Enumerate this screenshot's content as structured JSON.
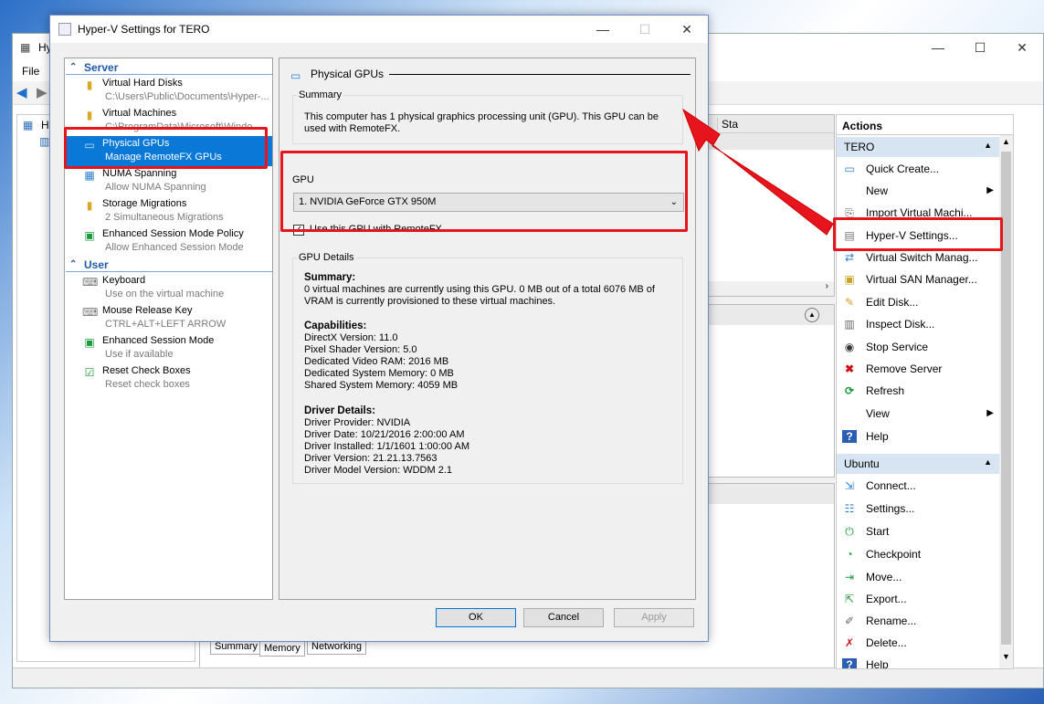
{
  "manager": {
    "title_fragment": "Hy",
    "menu": [
      "File"
    ],
    "tree_item": "Hy",
    "column_fragment": "Sta",
    "tabs": [
      "Summary",
      "Memory",
      "Networking"
    ]
  },
  "actions": {
    "header": "Actions",
    "groups": [
      {
        "name": "TERO",
        "items": [
          {
            "label": "Quick Create...",
            "icon": "monitor-icon"
          },
          {
            "label": "New",
            "icon": "none",
            "submenu": true
          },
          {
            "label": "Import Virtual Machi...",
            "icon": "import-icon"
          },
          {
            "label": "Hyper-V Settings...",
            "icon": "settings-doc-icon"
          },
          {
            "label": "Virtual Switch Manag...",
            "icon": "switch-icon"
          },
          {
            "label": "Virtual SAN Manager...",
            "icon": "san-icon"
          },
          {
            "label": "Edit Disk...",
            "icon": "edit-disk-icon"
          },
          {
            "label": "Inspect Disk...",
            "icon": "inspect-disk-icon"
          },
          {
            "label": "Stop Service",
            "icon": "stop-icon"
          },
          {
            "label": "Remove Server",
            "icon": "remove-icon"
          },
          {
            "label": "Refresh",
            "icon": "refresh-icon"
          },
          {
            "label": "View",
            "icon": "none",
            "submenu": true
          },
          {
            "label": "Help",
            "icon": "help-icon"
          }
        ]
      },
      {
        "name": "Ubuntu",
        "items": [
          {
            "label": "Connect...",
            "icon": "connect-icon"
          },
          {
            "label": "Settings...",
            "icon": "settings-icon"
          },
          {
            "label": "Start",
            "icon": "start-icon"
          },
          {
            "label": "Checkpoint",
            "icon": "checkpoint-icon"
          },
          {
            "label": "Move...",
            "icon": "move-icon"
          },
          {
            "label": "Export...",
            "icon": "export-icon"
          },
          {
            "label": "Rename...",
            "icon": "rename-icon"
          },
          {
            "label": "Delete...",
            "icon": "delete-icon"
          },
          {
            "label": "Help",
            "icon": "help-icon"
          }
        ]
      }
    ]
  },
  "dialog": {
    "title": "Hyper-V Settings for TERO",
    "nav": {
      "server_header": "Server",
      "user_header": "User",
      "server_items": [
        {
          "title": "Virtual Hard Disks",
          "subtitle": "C:\\Users\\Public\\Documents\\Hyper-...",
          "icon": "folder-icon"
        },
        {
          "title": "Virtual Machines",
          "subtitle": "C:\\ProgramData\\Microsoft\\Windo...",
          "icon": "folder-icon"
        },
        {
          "title": "Physical GPUs",
          "subtitle": "Manage RemoteFX GPUs",
          "icon": "gpu-icon",
          "selected": true
        },
        {
          "title": "NUMA Spanning",
          "subtitle": "Allow NUMA Spanning",
          "icon": "numa-icon"
        },
        {
          "title": "Storage Migrations",
          "subtitle": "2 Simultaneous Migrations",
          "icon": "storage-icon"
        },
        {
          "title": "Enhanced Session Mode Policy",
          "subtitle": "Allow Enhanced Session Mode",
          "icon": "session-icon"
        }
      ],
      "user_items": [
        {
          "title": "Keyboard",
          "subtitle": "Use on the virtual machine",
          "icon": "keyboard-icon"
        },
        {
          "title": "Mouse Release Key",
          "subtitle": "CTRL+ALT+LEFT ARROW",
          "icon": "mouse-icon"
        },
        {
          "title": "Enhanced Session Mode",
          "subtitle": "Use if available",
          "icon": "session-icon"
        },
        {
          "title": "Reset Check Boxes",
          "subtitle": "Reset check boxes",
          "icon": "reset-check-icon"
        }
      ]
    },
    "page": {
      "heading": "Physical GPUs",
      "summary_legend": "Summary",
      "summary_text": "This computer has 1 physical graphics processing unit (GPU). This GPU can be used with RemoteFX.",
      "gpu_label": "GPU",
      "gpu_selected": "1. NVIDIA GeForce GTX 950M",
      "use_gpu_checked": true,
      "use_gpu_label": "Use this GPU with RemoteFX",
      "details_legend": "GPU Details",
      "summary_heading": "Summary:",
      "summary_lines": [
        "0 virtual machines are currently using this GPU. 0 MB out of a total 6076 MB of",
        "VRAM is currently provisioned to these virtual machines."
      ],
      "capabilities_heading": "Capabilities:",
      "capabilities": [
        "DirectX Version: 11.0",
        "Pixel Shader Version: 5.0",
        "Dedicated Video RAM: 2016 MB",
        "Dedicated System Memory: 0 MB",
        "Shared System Memory: 4059 MB"
      ],
      "driver_heading": "Driver Details:",
      "driver": [
        "Driver Provider: NVIDIA",
        "Driver Date: 10/21/2016 2:00:00 AM",
        "Driver Installed: 1/1/1601 1:00:00 AM",
        "Driver Version: 21.21.13.7563",
        "Driver Model Version: WDDM 2.1"
      ]
    },
    "buttons": {
      "ok": "OK",
      "cancel": "Cancel",
      "apply": "Apply"
    }
  },
  "colors": {
    "selection": "#0a78d7",
    "highlight_box": "#e6141c",
    "group_header": "#d7e4f2"
  }
}
